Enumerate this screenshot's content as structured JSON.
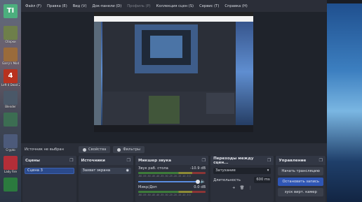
{
  "desktop": {
    "icons": [
      {
        "label": "",
        "color": "#4caf7e",
        "glyph": "TI"
      },
      {
        "label": "Сборки",
        "color": "#6e7f4a",
        "glyph": ""
      },
      {
        "label": "Garry's Mod",
        "color": "#9a6b3b",
        "glyph": ""
      },
      {
        "label": "Left 4 Dead 2",
        "color": "#b8321f",
        "glyph": "4"
      },
      {
        "label": "Blender",
        "color": "#4a5868",
        "glyph": ""
      },
      {
        "label": "",
        "color": "#3c6d52",
        "glyph": ""
      },
      {
        "label": "Crypto",
        "color": "#4c5a7a",
        "glyph": ""
      },
      {
        "label": "Lady Fire",
        "color": "#b32e38",
        "glyph": ""
      },
      {
        "label": "",
        "color": "#2b7a3e",
        "glyph": ""
      }
    ]
  },
  "menubar": {
    "items": [
      {
        "label": "Файл (F)",
        "enabled": true
      },
      {
        "label": "Правка (E)",
        "enabled": true
      },
      {
        "label": "Вид (V)",
        "enabled": true
      },
      {
        "label": "Док-панели (D)",
        "enabled": true
      },
      {
        "label": "Профиль (P)",
        "enabled": false
      },
      {
        "label": "Коллекция сцен (S)",
        "enabled": true
      },
      {
        "label": "Сервис (T)",
        "enabled": true
      },
      {
        "label": "Справка (H)",
        "enabled": true
      }
    ]
  },
  "statusbar": {
    "no_source": "Источник не выбран",
    "properties_label": "Свойства",
    "filters_label": "Фильтры"
  },
  "scenes": {
    "title": "Сцены",
    "items": [
      "Сцена 3"
    ]
  },
  "sources": {
    "title": "Источники",
    "items": [
      "Захват экрана"
    ]
  },
  "mixer": {
    "title": "Микшер звука",
    "channels": [
      {
        "name": "Звук раб. стола",
        "level": "-10.9 dB"
      },
      {
        "name": "Микр/Доп",
        "level": "0.0 dB"
      }
    ],
    "ticks": "-60 -55 -50 -45 -40 -35 -30 -25 -20 -15 -10 -5 0"
  },
  "transitions": {
    "title": "Переходы между сцен...",
    "type_value": "Затухание",
    "duration_label": "Длительность",
    "duration_value": "600 ms"
  },
  "controls": {
    "title": "Управление",
    "start_stream": "Начать трансляцию",
    "stop_record": "Остановить запись",
    "virtual_cam": "зуск вирт. камер"
  }
}
